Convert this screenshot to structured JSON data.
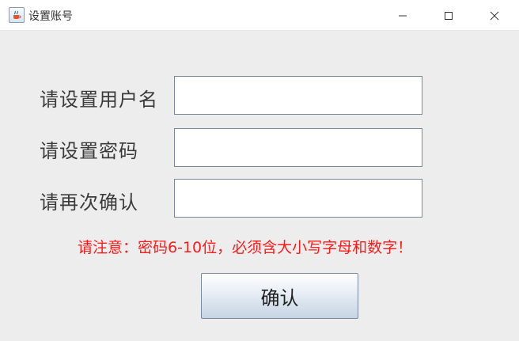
{
  "window": {
    "title": "设置账号",
    "app_icon": "java-coffee-icon",
    "controls": {
      "minimize_icon": "minimize-icon",
      "maximize_icon": "maximize-icon",
      "close_icon": "close-icon"
    }
  },
  "form": {
    "username_label": "请设置用户名",
    "username_value": "",
    "password_label": "请设置密码",
    "password_value": "",
    "confirm_label": "请再次确认",
    "confirm_value": "",
    "notice": "请注意：密码6-10位，必须含大小写字母和数字！",
    "notice_color": "#ff1a1a",
    "confirm_button_label": "确认"
  }
}
